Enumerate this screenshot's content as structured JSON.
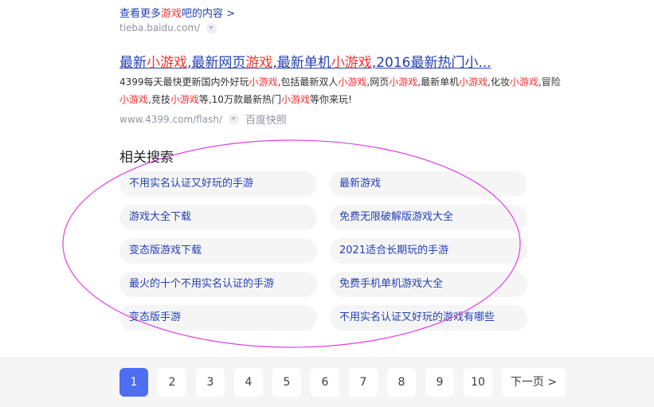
{
  "more": {
    "pre": "查看更多",
    "hl": "游戏",
    "post": "吧的内容 >"
  },
  "source1": {
    "url": "tieba.baidu.com/"
  },
  "result": {
    "title_parts": [
      {
        "t": "最新",
        "hl": false
      },
      {
        "t": "小游戏",
        "hl": true
      },
      {
        "t": ",最新网页",
        "hl": false
      },
      {
        "t": "游戏",
        "hl": true
      },
      {
        "t": ",最新单机",
        "hl": false
      },
      {
        "t": "小游戏",
        "hl": true
      },
      {
        "t": ",2016最新热门小...",
        "hl": false
      }
    ],
    "abstract_parts": [
      {
        "t": "4399每天最快更新国内外好玩",
        "hl": false
      },
      {
        "t": "小游戏",
        "hl": true
      },
      {
        "t": ",包括最新双人",
        "hl": false
      },
      {
        "t": "小游戏",
        "hl": true
      },
      {
        "t": ",网页",
        "hl": false
      },
      {
        "t": "小游戏",
        "hl": true
      },
      {
        "t": ",最新单机",
        "hl": false
      },
      {
        "t": "小游戏",
        "hl": true
      },
      {
        "t": ",化妆",
        "hl": false
      },
      {
        "t": "小游戏",
        "hl": true
      },
      {
        "t": ",冒险",
        "hl": false
      },
      {
        "t": "小游戏",
        "hl": true
      },
      {
        "t": ",竞技",
        "hl": false
      },
      {
        "t": "小游戏",
        "hl": true
      },
      {
        "t": "等,10万款最新热门",
        "hl": false
      },
      {
        "t": "小游戏",
        "hl": true
      },
      {
        "t": "等你来玩!",
        "hl": false
      }
    ],
    "url": "www.4399.com/flash/",
    "kuaizhao": "百度快照"
  },
  "related": {
    "title": "相关搜索",
    "items": [
      "不用实名认证又好玩的手游",
      "最新游戏",
      "游戏大全下载",
      "免费无限破解版游戏大全",
      "变态版游戏下载",
      "2021适合长期玩的手游",
      "最火的十个不用实名认证的手游",
      "免费手机单机游戏大全",
      "变态版手游",
      "不用实名认证又好玩的游戏有哪些"
    ]
  },
  "pagination": {
    "pages": [
      "1",
      "2",
      "3",
      "4",
      "5",
      "6",
      "7",
      "8",
      "9",
      "10"
    ],
    "current": "1",
    "next_label": "下一页 >"
  },
  "annotation": {
    "color": "#e040e0",
    "shape": "ellipse"
  }
}
